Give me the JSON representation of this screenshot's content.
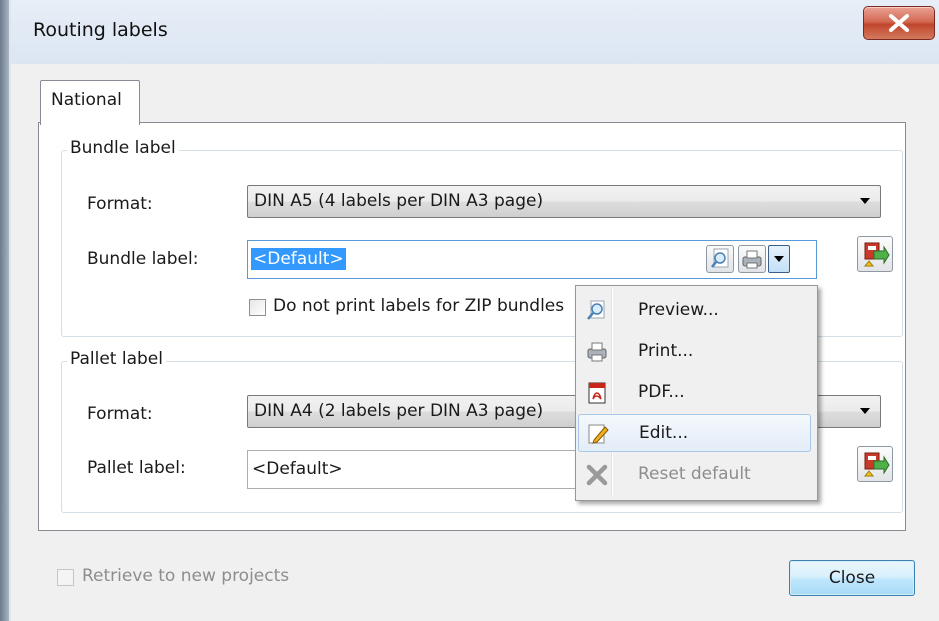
{
  "window": {
    "title": "Routing labels"
  },
  "tabs": [
    {
      "label": "National"
    }
  ],
  "bundle": {
    "group_label": "Bundle label",
    "format_label": "Format:",
    "format_value": "DIN A5 (4 labels per DIN A3 page)",
    "label_label": "Bundle label:",
    "label_value": "<Default>",
    "zip_checkbox_label": "Do not print labels for ZIP bundles",
    "zip_checked": false
  },
  "pallet": {
    "group_label": "Pallet label",
    "format_label": "Format:",
    "format_value": "DIN A4 (2 labels per DIN A3 page)",
    "label_label": "Pallet label:",
    "label_value": "<Default>"
  },
  "context_menu": {
    "items": [
      {
        "label": "Preview...",
        "icon": "preview-icon",
        "enabled": true
      },
      {
        "label": "Print...",
        "icon": "printer-icon",
        "enabled": true
      },
      {
        "label": "PDF...",
        "icon": "pdf-icon",
        "enabled": true
      },
      {
        "label": "Edit...",
        "icon": "edit-pencil-icon",
        "enabled": true,
        "highlighted": true
      },
      {
        "label": "Reset default",
        "icon": "reset-x-icon",
        "enabled": false
      }
    ]
  },
  "footer": {
    "retrieve_label": "Retrieve to new projects",
    "retrieve_checked": false,
    "retrieve_enabled": false,
    "close_label": "Close"
  },
  "colors": {
    "selection": "#3399ff",
    "close_x": "#c0462d",
    "focus_border": "#5a9ad8"
  }
}
